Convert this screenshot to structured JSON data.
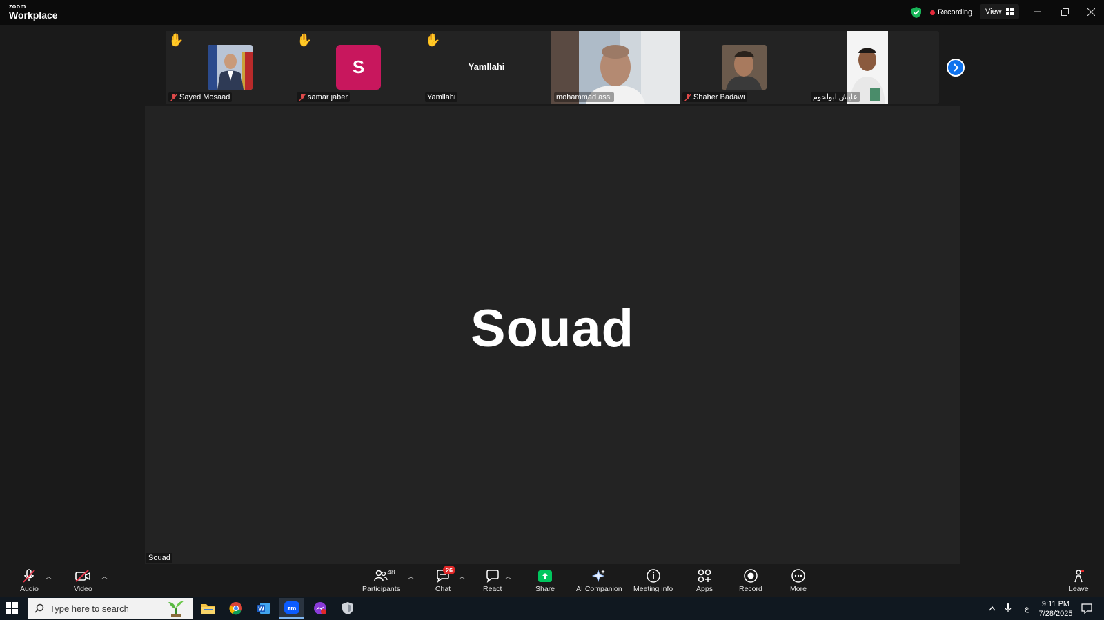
{
  "titlebar": {
    "logo_small": "zoom",
    "logo_big": "Workplace",
    "recording_label": "Recording",
    "view_label": "View"
  },
  "thumbnails": [
    {
      "name": "Sayed Mosaad",
      "hand_raised": true,
      "muted": true,
      "type": "photo"
    },
    {
      "name": "samar jaber",
      "hand_raised": true,
      "muted": true,
      "type": "initial",
      "initial": "S"
    },
    {
      "name": "Yamllahi",
      "hand_raised": true,
      "muted": false,
      "type": "text",
      "display": "Yamllahi"
    },
    {
      "name": "mohammad assi",
      "hand_raised": false,
      "muted": false,
      "type": "video"
    },
    {
      "name": "Shaher Badawi",
      "hand_raised": false,
      "muted": true,
      "type": "photo"
    },
    {
      "name": "عايش ابولحوم",
      "hand_raised": false,
      "muted": false,
      "type": "photo"
    }
  ],
  "main_speaker": {
    "display_name": "Souad",
    "label": "Souad"
  },
  "toolbar": {
    "audio": "Audio",
    "video": "Video",
    "participants": "Participants",
    "participants_count": "48",
    "chat": "Chat",
    "chat_badge": "26",
    "react": "React",
    "share": "Share",
    "ai_companion": "AI Companion",
    "meeting_info": "Meeting info",
    "apps": "Apps",
    "record": "Record",
    "more": "More",
    "leave": "Leave"
  },
  "taskbar": {
    "search_placeholder": "Type here to search",
    "time": "9:11 PM",
    "date": "7/28/2025",
    "lang": "ع"
  },
  "colors": {
    "accent_blue": "#0e72ed",
    "record_red": "#e5293a",
    "share_green": "#00c65e",
    "avatar_pink": "#c8175d"
  }
}
